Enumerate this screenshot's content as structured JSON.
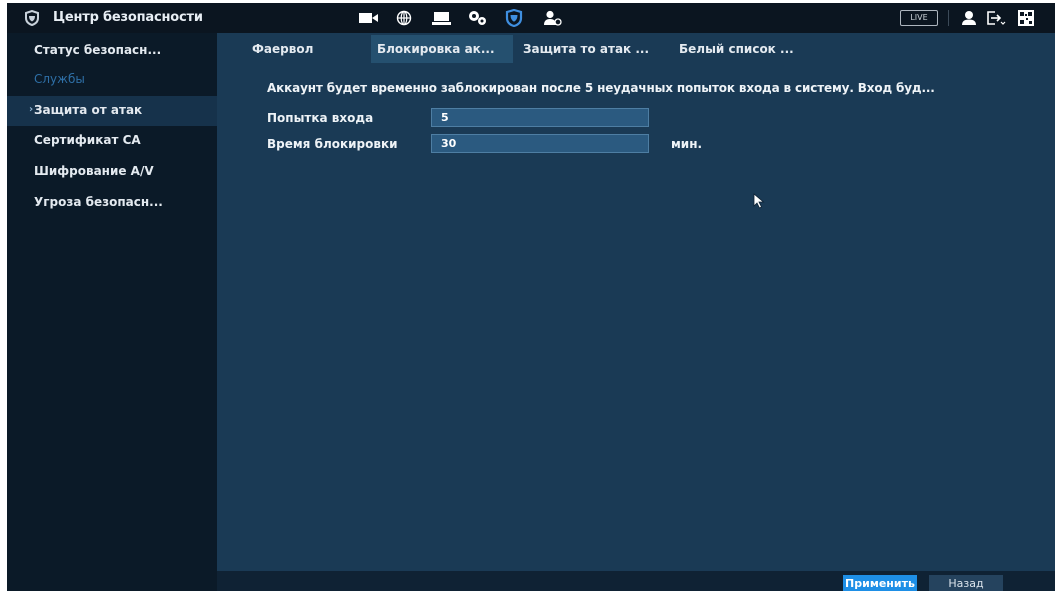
{
  "header": {
    "title": "Центр безопасности",
    "live_label": "LIVE",
    "icons": [
      "shield-icon",
      "camera-icon",
      "network-icon",
      "storage-icon",
      "system-icon",
      "security-icon",
      "account-icon",
      "user-icon",
      "logout-icon",
      "qr-icon"
    ]
  },
  "sidebar": {
    "items": [
      {
        "label": "Статус безопасн..."
      },
      {
        "label": "Службы"
      },
      {
        "label": "Защита от атак"
      },
      {
        "label": "Сертификат CA"
      },
      {
        "label": "Шифрование A/V"
      },
      {
        "label": "Угроза безопасн..."
      }
    ],
    "selected_arrow": "›"
  },
  "tabs": [
    {
      "label": "Фаервол"
    },
    {
      "label": "Блокировка ак..."
    },
    {
      "label": "Защита то атак ..."
    },
    {
      "label": "Белый список ..."
    }
  ],
  "main": {
    "notice": "Аккаунт будет временно заблокирован после 5 неудачных попыток входа в систему. Вход буд...",
    "login_attempt": {
      "label": "Попытка входа",
      "value": "5"
    },
    "lock_time": {
      "label": "Время блокировки",
      "value": "30",
      "unit": "мин."
    }
  },
  "footer": {
    "apply_label": "Применить",
    "back_label": "Назад"
  },
  "colors": {
    "background": "#0f2234",
    "sidebar": "#0b1a28",
    "panel": "#1a3a55",
    "accent": "#1e8fe6",
    "security_icon": "#3f8fe0"
  }
}
